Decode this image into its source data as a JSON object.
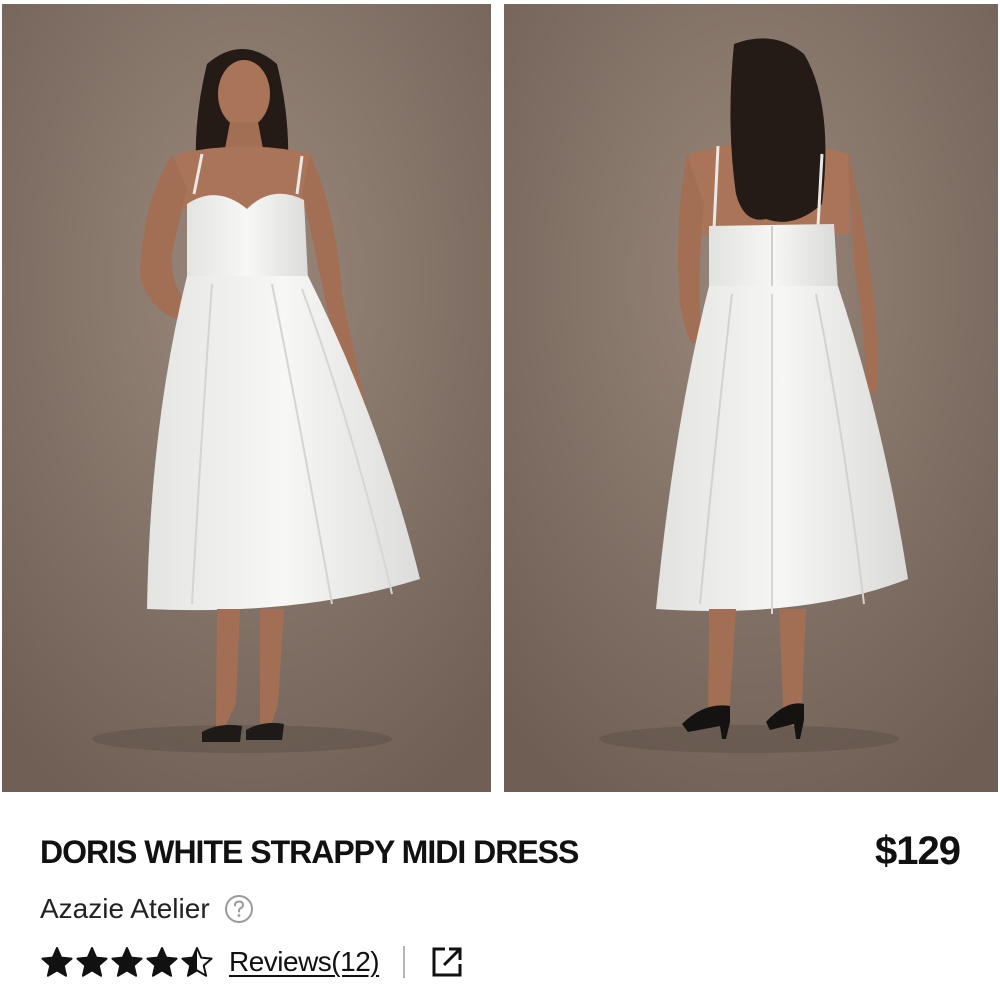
{
  "product": {
    "title": "DORIS WHITE STRAPPY MIDI DRESS",
    "price": "$129",
    "brand": "Azazie Atelier",
    "rating": 4.5,
    "rating_max": 5,
    "reviews_label": "Reviews(12)"
  },
  "gallery": {
    "images": [
      {
        "view": "front",
        "backdrop": "#8d7a6d",
        "dress": "#f3f3f1"
      },
      {
        "view": "back",
        "backdrop": "#8a786c",
        "dress": "#f3f3f1"
      }
    ]
  },
  "icons": {
    "help": "question-circle-icon",
    "share": "external-link-icon",
    "star": "star-icon"
  },
  "colors": {
    "text": "#111111",
    "divider": "#b5b5b5"
  }
}
